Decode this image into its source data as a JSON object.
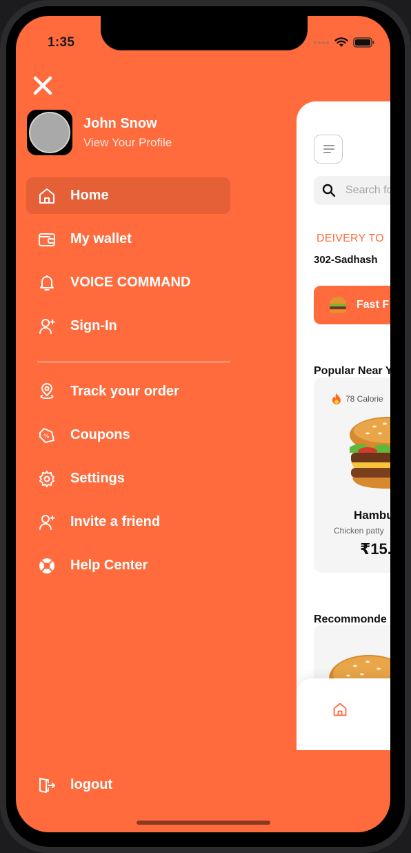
{
  "status_bar": {
    "time": "1:35"
  },
  "profile": {
    "name": "John Snow",
    "subtitle": "View Your Profile"
  },
  "menu_primary": [
    {
      "label": "Home",
      "icon": "home-icon",
      "active": true
    },
    {
      "label": "My wallet",
      "icon": "wallet-icon"
    },
    {
      "label": "VOICE COMMAND",
      "icon": "bell-icon"
    },
    {
      "label": "Sign-In",
      "icon": "user-add-icon"
    }
  ],
  "menu_secondary": [
    {
      "label": "Track your order",
      "icon": "location-pin-icon"
    },
    {
      "label": "Coupons",
      "icon": "coupon-icon"
    },
    {
      "label": "Settings",
      "icon": "gear-icon"
    },
    {
      "label": "Invite a friend",
      "icon": "user-add-icon"
    },
    {
      "label": "Help Center",
      "icon": "lifebuoy-icon"
    }
  ],
  "logout": {
    "label": "logout",
    "icon": "logout-icon"
  },
  "preview": {
    "search_placeholder": "Search fo",
    "delivery_label": "DEIVERY TO",
    "address": "302-Sadhash",
    "category": "Fast F",
    "popular_heading": "Popular Near Y",
    "food_card": {
      "calories": "78 Calorie",
      "name": "Hambu",
      "description": "Chicken patty",
      "price": "₹15."
    },
    "recommended_heading": "Recommonde"
  },
  "colors": {
    "accent": "#FF6B3D",
    "active_item": "#E55F37"
  }
}
